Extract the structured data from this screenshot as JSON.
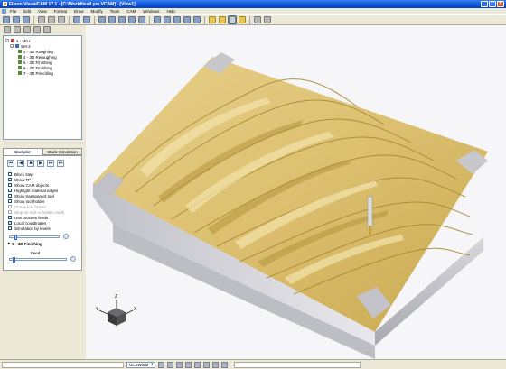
{
  "window": {
    "title": "Filson VisualCAM 17.1 - [C:\\Workfiles\\Lyre.VCAM] - [View1]",
    "controls": [
      "_",
      "□",
      "✕"
    ]
  },
  "menu": {
    "items": [
      "File",
      "Edit",
      "View",
      "Format",
      "Draw",
      "Modify",
      "Tools",
      "CAM",
      "Windows",
      "Help"
    ]
  },
  "tree": {
    "root": "1 - MILL",
    "setup": "Set-2",
    "ops": [
      "2 - 3D Roughing",
      "4 - 3D Reroughing",
      "5 - 3D Finishing",
      "6 - 3D Finishing",
      "7 - 3D Pencilling"
    ]
  },
  "tabs": [
    "Backplot",
    "Stock Simulation"
  ],
  "controls": {
    "play_glyphs": [
      "⏮",
      "◀",
      "■",
      "▶",
      "⏭",
      "⏭"
    ],
    "options": [
      {
        "label": "Block step",
        "checked": false,
        "enabled": true
      },
      {
        "label": "Show TP",
        "checked": false,
        "enabled": true
      },
      {
        "label": "Show CAM objects",
        "checked": false,
        "enabled": true
      },
      {
        "label": "Highlight material edges",
        "checked": false,
        "enabled": true
      },
      {
        "label": "Show transparent tool",
        "checked": false,
        "enabled": true
      },
      {
        "label": "Show tool holder",
        "checked": false,
        "enabled": true
      },
      {
        "label": "Check tool holder",
        "checked": false,
        "enabled": false
      },
      {
        "label": "Stop on tool or holder crash",
        "checked": false,
        "enabled": false
      },
      {
        "label": "Use process feeds",
        "checked": false,
        "enabled": true
      },
      {
        "label": "Local coordinates",
        "checked": true,
        "enabled": true
      },
      {
        "label": "Simulation by levels",
        "checked": false,
        "enabled": true
      }
    ],
    "section_title": "5 - 3D Finishing",
    "feed_label": "Feed",
    "step_slider": 0.1,
    "feed_slider": 0.05
  },
  "viewport": {
    "axis_labels": {
      "x": "X",
      "y": "Y",
      "z": "Z"
    }
  },
  "status": {
    "ucs": "UCSWorld"
  }
}
